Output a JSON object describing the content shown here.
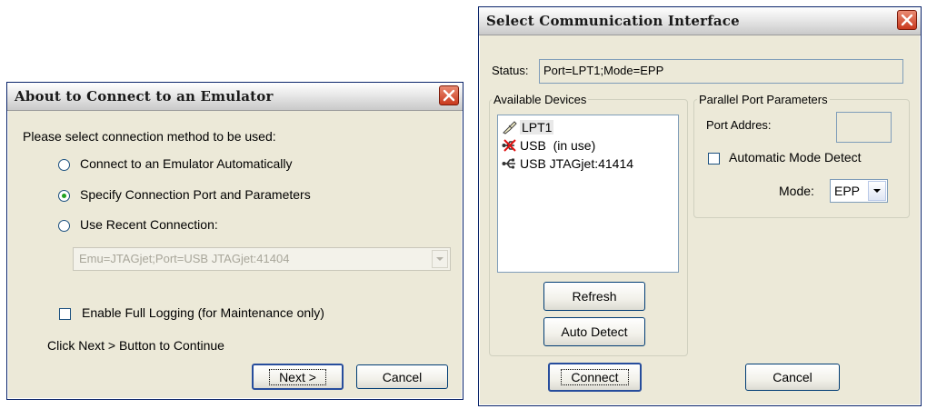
{
  "connect_dialog": {
    "title": "About to Connect to an Emulator",
    "prompt": "Please select connection method to be used:",
    "options": [
      {
        "label": "Connect to an Emulator Automatically",
        "checked": false
      },
      {
        "label": "Specify Connection Port and Parameters",
        "checked": true
      },
      {
        "label": "Use Recent Connection:",
        "checked": false
      }
    ],
    "recent_connection_value": "Emu=JTAGjet;Port=USB JTAGjet:41404",
    "logging_label": "Enable Full Logging (for Maintenance only)",
    "logging_checked": false,
    "hint": "Click Next > Button to Continue",
    "next_label": "Next >",
    "cancel_label": "Cancel"
  },
  "interface_dialog": {
    "title": "Select Communication Interface",
    "status_label": "Status:",
    "status_value": "Port=LPT1;Mode=EPP",
    "devices_group_label": "Available Devices",
    "devices": [
      {
        "label": "LPT1",
        "icon": "parallel-port-icon"
      },
      {
        "label": "USB  (in use)",
        "icon": "usb-in-use-icon"
      },
      {
        "label": "USB JTAGjet:41414",
        "icon": "usb-icon"
      }
    ],
    "refresh_label": "Refresh",
    "auto_detect_label": "Auto Detect",
    "params_group_label": "Parallel Port Parameters",
    "port_address_label": "Port Addres:",
    "port_address_value": "",
    "auto_mode_label": "Automatic Mode Detect",
    "auto_mode_checked": false,
    "mode_label": "Mode:",
    "mode_value": "EPP",
    "connect_label": "Connect",
    "cancel_label": "Cancel"
  },
  "colors": {
    "dialog_bg": "#ece9d8",
    "close_button": "#c9391e",
    "radio_dot": "#21a121",
    "field_border": "#7f9db9"
  }
}
